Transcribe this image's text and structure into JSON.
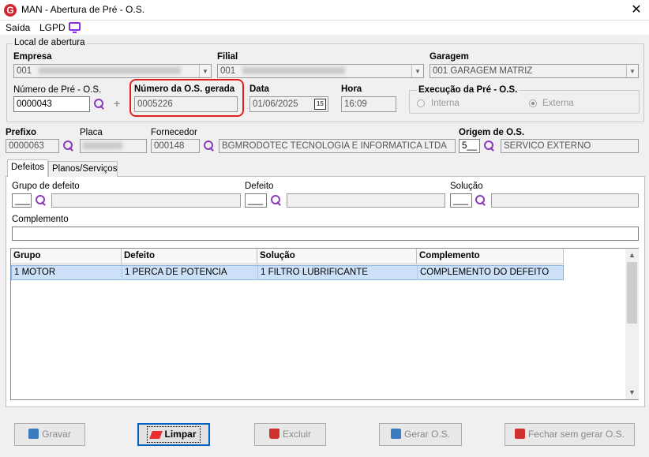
{
  "window": {
    "title": "MAN - Abertura de Pré - O.S.",
    "logo_letter": "G"
  },
  "menu": {
    "saida": "Saída",
    "lgpd": "LGPD"
  },
  "local": {
    "legend": "Local de abertura",
    "empresa_label": "Empresa",
    "empresa_value": "001",
    "filial_label": "Filial",
    "filial_value": "001",
    "garagem_label": "Garagem",
    "garagem_value": "001 GARAGEM MATRIZ",
    "numero_pre_label": "Número de Pré - O.S.",
    "numero_pre_value": "0000043",
    "numero_os_label": "Número da O.S. gerada",
    "numero_os_value": "0005226",
    "data_label": "Data",
    "data_value": "01/06/2025",
    "cal_text": "15",
    "hora_label": "Hora",
    "hora_value": "16:09",
    "execucao_legend": "Execução da Pré - O.S.",
    "interna_label": "Interna",
    "externa_label": "Externa"
  },
  "header_row": {
    "prefixo_label": "Prefixo",
    "prefixo_value": "0000063",
    "placa_label": "Placa",
    "fornecedor_label": "Fornecedor",
    "fornecedor_code": "000148",
    "fornecedor_name": "BGMRODOTEC TECNOLOGIA E INFORMATICA LTDA",
    "origem_label": "Origem de O.S.",
    "origem_code": "5__",
    "origem_name": "SERVICO EXTERNO"
  },
  "tabs": {
    "defeitos": "Defeitos",
    "planos": "Planos/Serviços"
  },
  "defeitos": {
    "grupo_label": "Grupo de defeito",
    "grupo_value": "___",
    "defeito_label": "Defeito",
    "defeito_value": "___",
    "solucao_label": "Solução",
    "solucao_value": "___",
    "complemento_label": "Complemento"
  },
  "grid": {
    "columns": [
      "Grupo",
      "Defeito",
      "Solução",
      "Complemento"
    ],
    "rows": [
      [
        "1 MOTOR",
        "1 PERCA DE POTENCIA",
        "1 FILTRO LUBRIFICANTE",
        "COMPLEMENTO DO DEFEITO"
      ]
    ]
  },
  "buttons": {
    "gravar": "Gravar",
    "limpar": "Limpar",
    "excluir": "Excluir",
    "gerar": "Gerar O.S.",
    "fechar": "Fechar sem gerar O.S."
  }
}
